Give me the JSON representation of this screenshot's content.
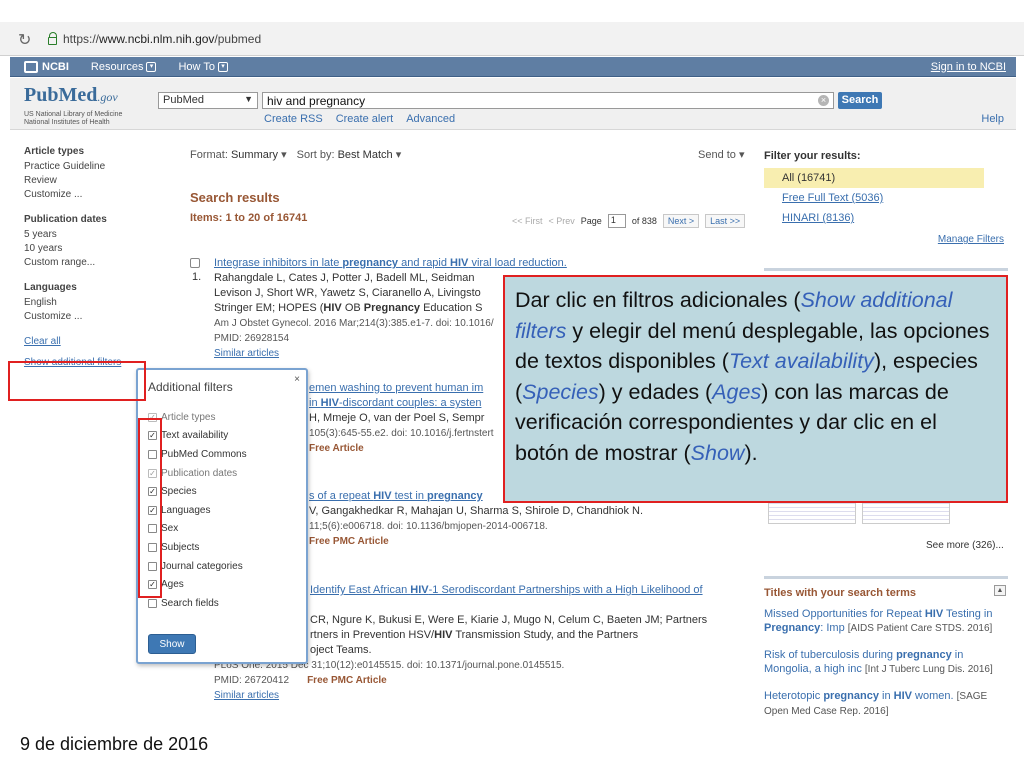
{
  "browser": {
    "url_prefix": "https://",
    "url_host": "www.ncbi.nlm.nih.gov",
    "url_path": "/pubmed"
  },
  "ncbi_bar": {
    "logo": "NCBI",
    "resources": "Resources",
    "how_to": "How To",
    "sign_in": "Sign in to NCBI"
  },
  "header": {
    "logo": "PubMed",
    "logo_gov": ".gov",
    "logo_sub_1": "US National Library of Medicine",
    "logo_sub_2": "National Institutes of Health",
    "database": "PubMed",
    "query": "hiv and pregnancy",
    "search_label": "Search",
    "links": [
      "Create RSS",
      "Create alert",
      "Advanced"
    ],
    "help": "Help"
  },
  "sidebar": {
    "groups": [
      {
        "title": "Article types",
        "options": [
          "Practice Guideline",
          "Review",
          "Customize ..."
        ]
      },
      {
        "title": "Publication dates",
        "options": [
          "5 years",
          "10 years",
          "Custom range..."
        ]
      },
      {
        "title": "Languages",
        "options": [
          "English",
          "Customize ..."
        ]
      }
    ],
    "clear_all": "Clear all",
    "show_additional": "Show additional filters"
  },
  "format_bar": {
    "format_label": "Format:",
    "format_value": "Summary",
    "sort_label": "Sort by:",
    "sort_value": "Best Match",
    "send_to": "Send to"
  },
  "results": {
    "title": "Search results",
    "items": "Items: 1 to 20 of 16741",
    "pager": {
      "first": "<< First",
      "prev": "< Prev",
      "page_label": "Page",
      "page": "1",
      "of": "of 838",
      "next": "Next >",
      "last": "Last >>"
    },
    "r1": {
      "title_a": "Integrase inhibitors in late ",
      "title_b": "pregnancy",
      "title_c": " and rapid ",
      "title_d": "HIV",
      "title_e": " viral load reduction.",
      "authors_1": "Rahangdale L, Cates J, Potter J, Badell ML, Seidman",
      "authors_2": "Levison J, Short WR, Yawetz S, Ciaranello A, Livingsto",
      "authors_3a": "Stringer EM; HOPES (",
      "authors_3b": "HIV",
      "authors_3c": " OB ",
      "authors_3d": "Pregnancy",
      "authors_3e": " Education S",
      "journal": "Am J Obstet Gynecol. 2016 Mar;214(3):385.e1-7. doi: 10.1016/",
      "pmid": "PMID: 26928154",
      "similar": "Similar articles"
    },
    "r2": {
      "title_a": "emen washing to prevent human im",
      "title_b": "in ",
      "title_c": "HIV",
      "title_d": "-discordant couples: a systen",
      "authors": "H, Mmeje O, van der Poel S, Sempr",
      "journal": "105(3):645-55.e2. doi: 10.1016/j.fertnstert",
      "free": "Free Article"
    },
    "r3": {
      "title_a": "s of a repeat ",
      "title_b": "HIV",
      "title_c": " test in ",
      "title_d": "pregnancy",
      "authors": "V, Gangakhedkar R, Mahajan U, Sharma S, Shirole D, Chandhiok N.",
      "journal": "11;5(6):e006718. doi: 10.1136/bmjopen-2014-006718.",
      "free": "Free PMC Article"
    },
    "r4": {
      "title_a": "Identify East African ",
      "title_b": "HIV",
      "title_c": "-1 Serodiscordant Partnerships with a High Likelihood of",
      "authors_1": "CR, Ngure K, Bukusi E, Were E, Kiarie J, Mugo N, Celum C, Baeten JM; Partners",
      "authors_2a": "rtners in Prevention HSV/",
      "authors_2b": "HIV",
      "authors_2c": " Transmission Study, and the Partners",
      "authors_3": "oject Teams.",
      "journal": "PLoS One. 2015 Dec 31;10(12):e0145515. doi: 10.1371/journal.pone.0145515.",
      "pmid": "PMID: 26720412",
      "free": "Free PMC Article",
      "similar": "Similar articles"
    }
  },
  "right_sidebar": {
    "filter_title": "Filter your results:",
    "filters": [
      "All (16741)",
      "Free Full Text (5036)",
      "HINARI (8136)"
    ],
    "manage": "Manage Filters",
    "see_more": "See more (326)...",
    "titles_heading": "Titles with your search terms",
    "t1_a": "Missed Opportunities for Repeat ",
    "t1_b": "HIV",
    "t1_c": " Testing in ",
    "t1_d": "Pregnancy",
    "t1_e": ": Imp",
    "t1_src": "[AIDS Patient Care STDS. 2016]",
    "t2_a": "Risk of tuberculosis during ",
    "t2_b": "pregnancy",
    "t2_c": " in Mongolia, a high inc",
    "t2_src": "[Int J Tuberc Lung Dis. 2016]",
    "t3_a": "Heterotopic ",
    "t3_b": "pregnancy",
    "t3_c": " in ",
    "t3_d": "HIV",
    "t3_e": " women.",
    "t3_src": "[SAGE Open Med Case Rep. 2016]"
  },
  "popup": {
    "title": "Additional filters",
    "close": "×",
    "items": [
      {
        "label": "Article types",
        "checked": true,
        "disabled": true
      },
      {
        "label": "Text availability",
        "checked": true,
        "disabled": false
      },
      {
        "label": "PubMed Commons",
        "checked": false,
        "disabled": false
      },
      {
        "label": "Publication dates",
        "checked": true,
        "disabled": true
      },
      {
        "label": "Species",
        "checked": true,
        "disabled": false
      },
      {
        "label": "Languages",
        "checked": true,
        "disabled": false
      },
      {
        "label": "Sex",
        "checked": false,
        "disabled": false
      },
      {
        "label": "Subjects",
        "checked": false,
        "disabled": false
      },
      {
        "label": "Journal categories",
        "checked": false,
        "disabled": false
      },
      {
        "label": "Ages",
        "checked": true,
        "disabled": false
      },
      {
        "label": "Search fields",
        "checked": false,
        "disabled": false
      }
    ],
    "show": "Show"
  },
  "callout": {
    "p1": "Dar clic en filtros adicionales (",
    "e1": "Show additional filters",
    "p2": " y elegir del menú desplegable, las opciones de textos disponibles (",
    "e2": "Text availability",
    "p3": "), especies (",
    "e3": "Species",
    "p4": ") y edades (",
    "e4": "Ages",
    "p5": ") con las marcas de verificación correspondientes y dar clic en el botón de mostrar (",
    "e5": "Show",
    "p6": ")."
  },
  "footer_date": "9 de diciembre de 2016",
  "colors": {
    "highlight_red": "#e02020",
    "callout_bg": "#bdd8df",
    "link_blue": "#3a6fae",
    "ncbi_bar": "#5f7ea3"
  }
}
